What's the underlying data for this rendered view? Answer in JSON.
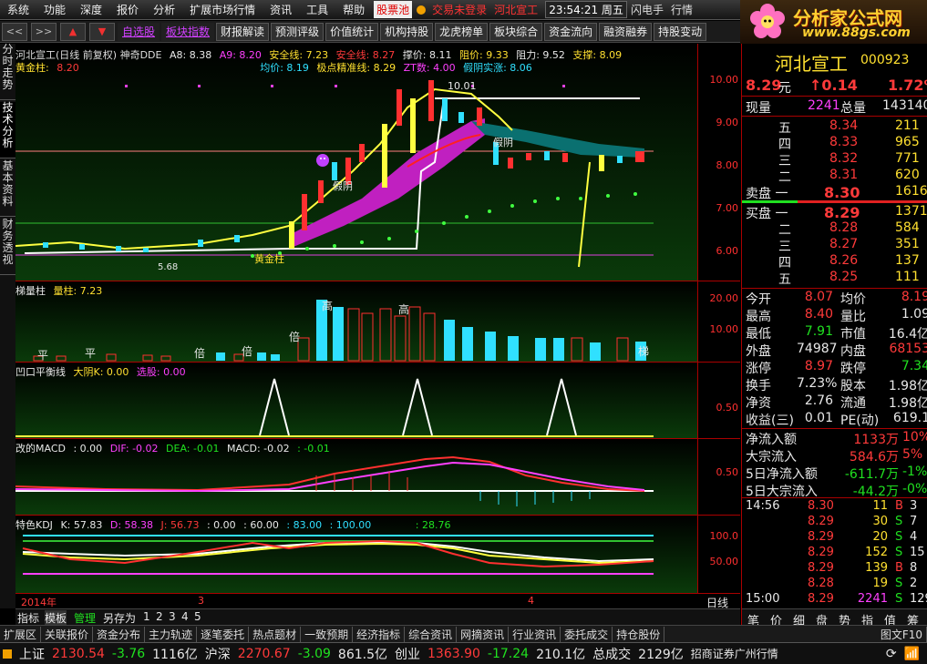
{
  "menu": {
    "items": [
      "系统",
      "功能",
      "深度",
      "报价",
      "分析",
      "扩展市场行情",
      "资讯",
      "工具",
      "帮助"
    ],
    "pool": "股票池",
    "trade": "交易未登录",
    "stock": "河北宣工",
    "time": "23:54:21",
    "weekday": "周五",
    "right1": "闪电手",
    "right2": "行情"
  },
  "logo": {
    "title": "分析家公式网",
    "url": "www.88gs.com"
  },
  "toolbar": {
    "icons": [
      "<<",
      ">>",
      "▲",
      "▼"
    ],
    "buttons": [
      "自选股",
      "板块指数",
      "财报解读",
      "预测评级",
      "价值统计",
      "机构持股",
      "龙虎榜单",
      "板块综合",
      "资金流向",
      "融资融券",
      "持股变动"
    ]
  },
  "left_tabs": [
    "分时走势",
    "技术分析",
    "基本资料",
    "财务透视"
  ],
  "main_header": {
    "title": "河北宣工(日线 前复权) 神奇DDE",
    "a8": "A8: 8.38",
    "a9": "A9: 8.20",
    "safe1": "安全线: 7.23",
    "safe2": "安全线: 8.27",
    "support": "撑价: 8.11",
    "resist_price": "阻价: 9.33",
    "resist": "阻力: 9.52",
    "prop": "支撑: 8.09",
    "gold": "黄金柱:",
    "gold_val": "8.20",
    "avg": "均价: 8.19",
    "pivot": "极点精准线: 8.29",
    "zt": "ZT数: 4.00",
    "yin": "假阴实涨: 8.06"
  },
  "chart_notes": {
    "peak": "10.01",
    "fake": "假阴",
    "gold_col": "黄金柱",
    "fake_yin": "假阴",
    "low": "5.68"
  },
  "panel2": {
    "title": "梯量柱",
    "sub": "量柱: 7.23",
    "labels": [
      "平",
      "平",
      "倍",
      "倍",
      "倍",
      "高",
      "高",
      "梯"
    ]
  },
  "panel3": {
    "title": "凹口平衡线",
    "sub1": "大阴K: 0.00",
    "sub2": "选股: 0.00"
  },
  "panel4": {
    "title": "改的MACD",
    "v0": ": 0.00",
    "dif": "DIF: -0.02",
    "dea": "DEA: -0.01",
    "macd": "MACD: -0.02",
    "v5": ": -0.01"
  },
  "panel5": {
    "title": "特色KDJ",
    "k": "K: 57.83",
    "d": "D: 58.38",
    "j": "J: 56.73",
    "l1": ": 0.00",
    "l2": ": 60.00",
    "l3": ": 83.00",
    "l4": ": 100.00",
    "l5": ": 28.76"
  },
  "axes": {
    "main": [
      "10.00",
      "9.00",
      "8.00",
      "7.00",
      "6.00"
    ],
    "vol": [
      "20.00",
      "10.00"
    ],
    "bal": [
      "0.50"
    ],
    "macd": [
      "0.50"
    ],
    "kdj": [
      "100.0",
      "50.00"
    ]
  },
  "xaxis": {
    "year": "2014年",
    "m3": "3",
    "m4": "4",
    "period": "日线"
  },
  "bottom_tabs": [
    "指标",
    "模板",
    "管理",
    "另存为",
    "1",
    "2",
    "3",
    "4",
    "5"
  ],
  "quote": {
    "name": "河北宣工",
    "code": "000923",
    "price": "8.29",
    "unit": "元",
    "change": "0.14",
    "pct": "1.72%",
    "now_label": "现量",
    "now_val": "2241",
    "total_label": "总量",
    "total_val": "143140",
    "asks": [
      {
        "lv": "五",
        "p": "8.34",
        "v": "211"
      },
      {
        "lv": "四",
        "p": "8.33",
        "v": "965"
      },
      {
        "lv": "三",
        "p": "8.32",
        "v": "771"
      },
      {
        "lv": "二",
        "p": "8.31",
        "v": "620"
      },
      {
        "lv": "卖盘 一",
        "p": "8.30",
        "v": "1616"
      }
    ],
    "bids": [
      {
        "lv": "买盘 一",
        "p": "8.29",
        "v": "1371"
      },
      {
        "lv": "二",
        "p": "8.28",
        "v": "584"
      },
      {
        "lv": "三",
        "p": "8.27",
        "v": "351"
      },
      {
        "lv": "四",
        "p": "8.26",
        "v": "137"
      },
      {
        "lv": "五",
        "p": "8.25",
        "v": "111"
      }
    ],
    "stats": [
      {
        "a": "今开",
        "av": "8.07",
        "b": "均价",
        "bv": "8.19"
      },
      {
        "a": "最高",
        "av": "8.40",
        "b": "量比",
        "bv": "1.09"
      },
      {
        "a": "最低",
        "av": "7.91",
        "b": "市值",
        "bv": "16.4亿"
      },
      {
        "a": "外盘",
        "av": "74987",
        "b": "内盘",
        "bv": "68153"
      },
      {
        "a": "涨停",
        "av": "8.97",
        "b": "跌停",
        "bv": "7.34"
      },
      {
        "a": "换手",
        "av": "7.23%",
        "b": "股本",
        "bv": "1.98亿"
      },
      {
        "a": "净资",
        "av": "2.76",
        "b": "流通",
        "bv": "1.98亿"
      },
      {
        "a": "收益(三)",
        "av": "0.01",
        "b": "PE(动)",
        "bv": "619.1"
      }
    ],
    "flows": [
      {
        "a": "净流入额",
        "av": "1133万",
        "bv": "10%"
      },
      {
        "a": "大宗流入",
        "av": "584.6万",
        "bv": "5%"
      },
      {
        "a": "5日净流入额",
        "av": "-611.7万",
        "bv": "-1%"
      },
      {
        "a": "5日大宗流入",
        "av": "-44.2万",
        "bv": "-0%"
      }
    ],
    "ticks": [
      {
        "t": "14:56",
        "p": "8.30",
        "v": "11",
        "s": "B",
        "n": "3"
      },
      {
        "t": "",
        "p": "8.29",
        "v": "30",
        "s": "S",
        "n": "7"
      },
      {
        "t": "",
        "p": "8.29",
        "v": "20",
        "s": "S",
        "n": "4"
      },
      {
        "t": "",
        "p": "8.29",
        "v": "152",
        "s": "S",
        "n": "15"
      },
      {
        "t": "",
        "p": "8.29",
        "v": "139",
        "s": "B",
        "n": "8"
      },
      {
        "t": "",
        "p": "8.28",
        "v": "19",
        "s": "S",
        "n": "2"
      },
      {
        "t": "15:00",
        "p": "8.29",
        "v": "2241",
        "s": "S",
        "n": "129"
      }
    ],
    "tabs": [
      "笔",
      "价",
      "细",
      "盘",
      "势",
      "指",
      "值",
      "筹"
    ]
  },
  "funcbar": [
    "扩展区",
    "关联报价",
    "资金分布",
    "主力轨迹",
    "逐笔委托",
    "热点题材",
    "一致预期",
    "经济指标",
    "综合资讯",
    "网摘资讯",
    "行业资讯",
    "委托成交",
    "持仓股份"
  ],
  "funcbar_right": "图文F10",
  "status": {
    "sh": "上证",
    "sh_v": "2130.54",
    "sh_c": "-3.76",
    "sh_a": "1116亿",
    "hs": "沪深",
    "hs_v": "2270.67",
    "hs_c": "-3.09",
    "hs_a": "861.5亿",
    "cy": "创业",
    "cy_v": "1363.90",
    "cy_c": "-17.24",
    "cy_a": "210.1亿",
    "total_l": "总成交",
    "total_v": "2129亿",
    "broker": "招商证券广州行情"
  },
  "colors": {
    "up": "#ff3a3a",
    "down": "#20e020",
    "accent": "#ff40ff"
  }
}
